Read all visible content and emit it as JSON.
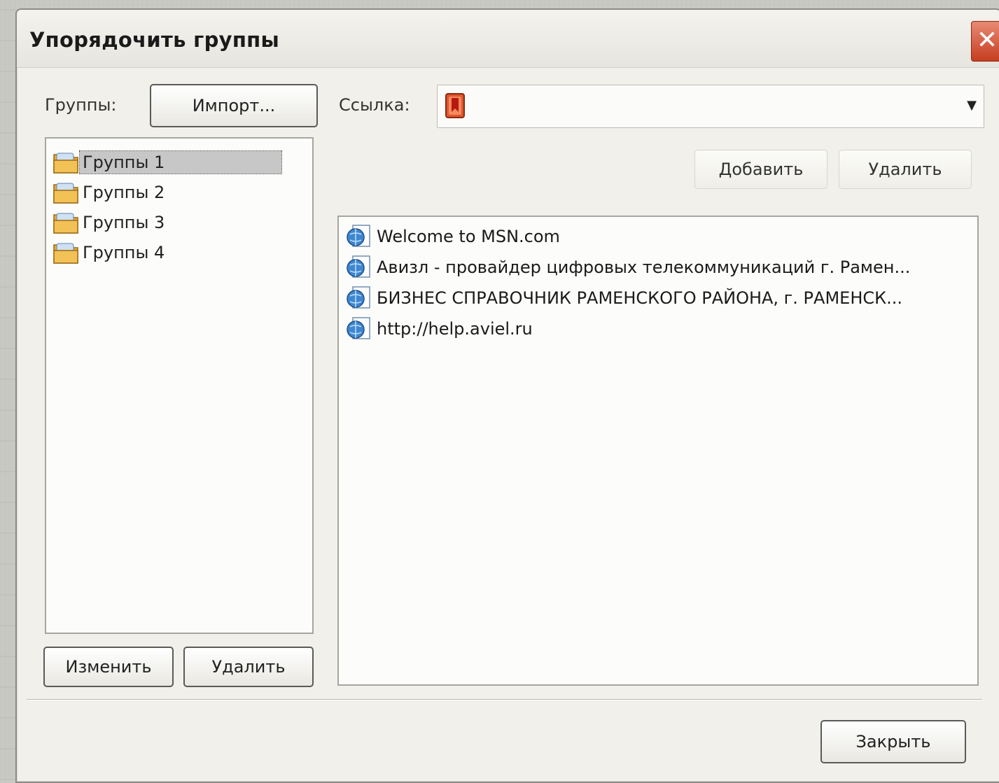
{
  "dialog": {
    "title": "Упорядочить группы",
    "close_symbol": "✕"
  },
  "groups": {
    "label": "Группы:",
    "import_label": "Импорт...",
    "items": [
      "Группы 1",
      "Группы 2",
      "Группы 3",
      "Группы 4"
    ],
    "selected_index": 0,
    "edit_label": "Изменить",
    "delete_label": "Удалить"
  },
  "link": {
    "label": "Ссылка:",
    "value": "",
    "add_label": "Добавить",
    "delete_label": "Удалить",
    "items": [
      "Welcome to MSN.com",
      "Авизл - провайдер цифровых телекоммуникаций г. Рамен...",
      "БИЗНЕС СПРАВОЧНИК РАМЕНСКОГО РАЙОНА, г. РАМЕНСК...",
      "http://help.aviel.ru"
    ]
  },
  "footer": {
    "close_label": "Закрыть"
  },
  "icons": {
    "folder": "folder-icon",
    "web_page": "web-page-icon",
    "bookmark": "bookmark-icon",
    "dropdown": "chevron-down-icon"
  },
  "colors": {
    "window_bg": "#f1f0ea",
    "close_button": "#c63d20",
    "selection": "#c7c7c7"
  }
}
